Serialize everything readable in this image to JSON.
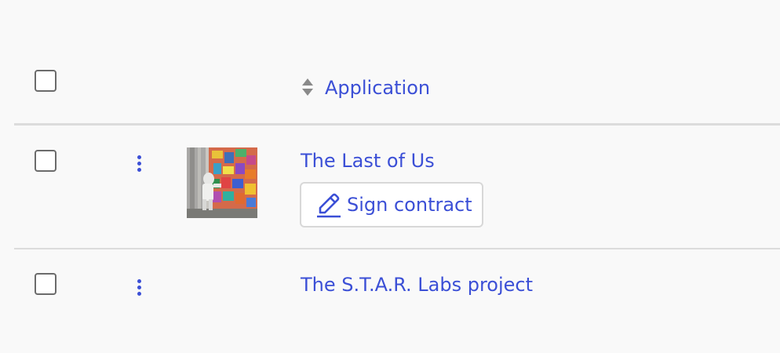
{
  "table": {
    "header": {
      "column_application": "Application"
    },
    "rows": [
      {
        "application": "The Last of Us",
        "action_label": "Sign contract",
        "has_thumbnail": true
      },
      {
        "application": "The S.T.A.R. Labs project",
        "has_thumbnail": false
      }
    ]
  },
  "colors": {
    "link": "#3b4fd6",
    "background": "#f9f9f9",
    "divider": "#dcdcdc",
    "checkbox_border": "#6b6b6b"
  },
  "icons": {
    "sort": "sort-icon",
    "kebab": "kebab-menu-icon",
    "pencil": "pencil-icon"
  }
}
